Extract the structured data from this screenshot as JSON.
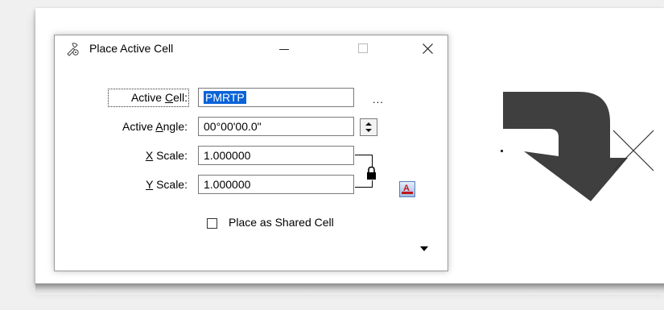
{
  "dialog": {
    "title": "Place Active Cell",
    "icon": "cell-tool-icon",
    "window_controls": {
      "minimize": "minimize-icon",
      "maximize": "maximize-icon",
      "close": "close-icon"
    }
  },
  "fields": {
    "active_cell": {
      "label_pre": "Active ",
      "label_accel": "C",
      "label_post": "ell:",
      "value": "PMRTP",
      "browse_label": "..."
    },
    "active_angle": {
      "label_pre": "Active ",
      "label_accel": "A",
      "label_post": "ngle:",
      "value": "00°00'00.0\""
    },
    "x_scale": {
      "label_accel": "X",
      "label_post": " Scale:",
      "value": "1.000000"
    },
    "y_scale": {
      "label_accel": "Y",
      "label_post": " Scale:",
      "value": "1.000000"
    }
  },
  "options": {
    "place_as_shared_cell": {
      "label": "Place as Shared Cell",
      "checked": false
    }
  },
  "icons": {
    "scale_lock": "lock-icon",
    "text_style": "text-style-icon",
    "expand": "chevron-down-icon",
    "canvas_arrow": "curved-arrow-graphic",
    "canvas_marker": "x-marker-graphic"
  },
  "colors": {
    "selection": "#0a63d8",
    "canvas_graphic": "#3f3f3f",
    "text_style_red": "#c0181b"
  }
}
